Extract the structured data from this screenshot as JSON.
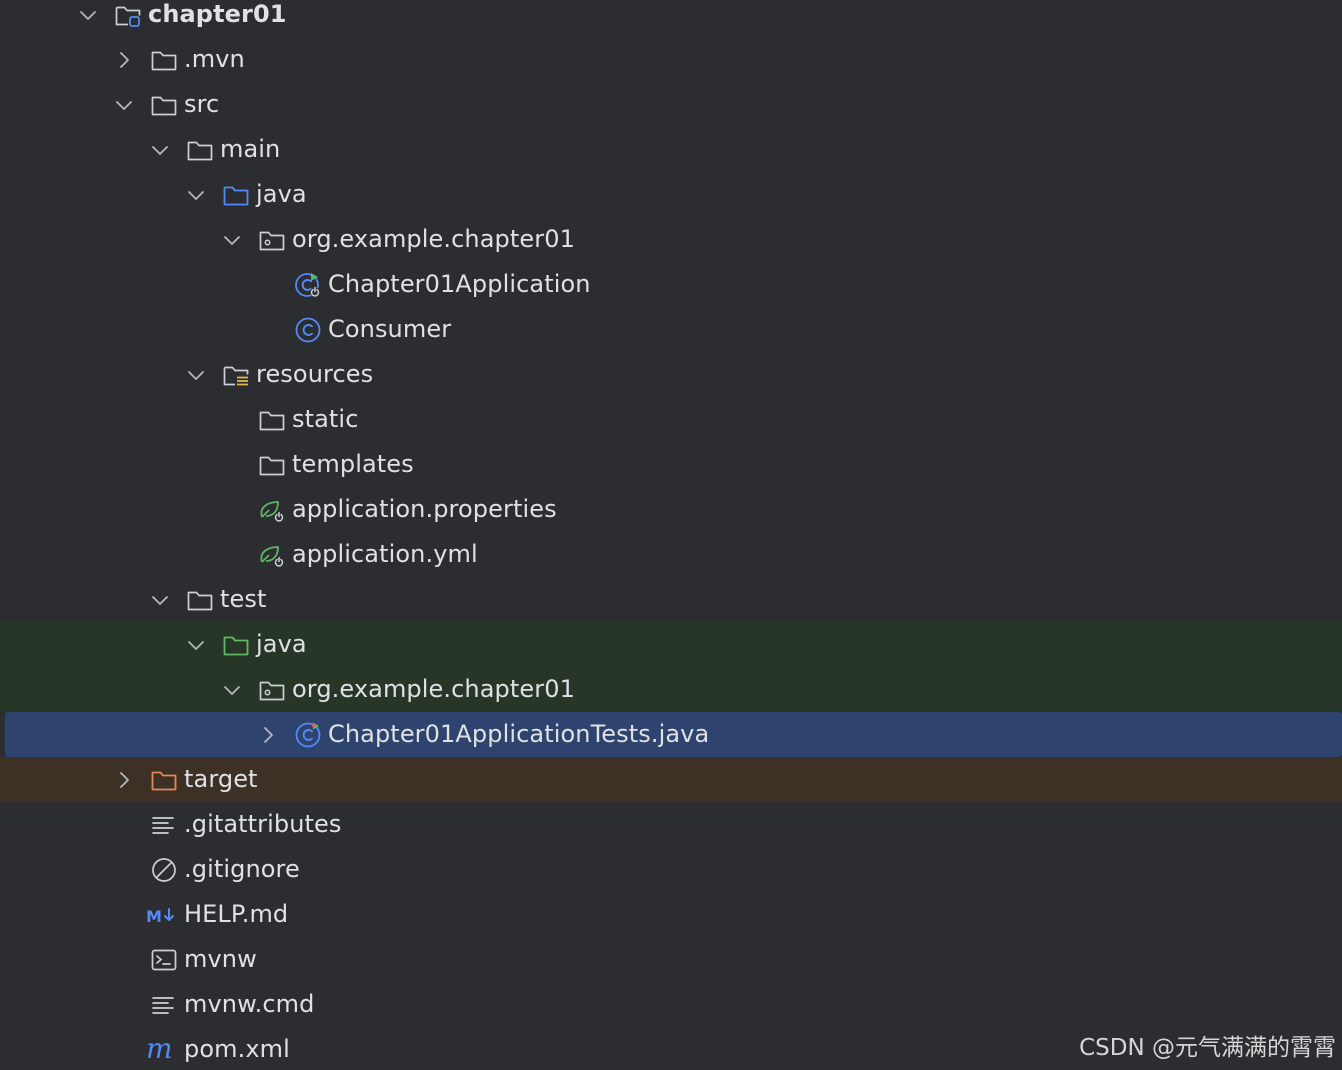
{
  "tree": {
    "items": [
      {
        "label": "chapter01",
        "depth": 0,
        "state": "expanded",
        "icon": "module-folder-icon",
        "bold": true
      },
      {
        "label": ".mvn",
        "depth": 1,
        "state": "collapsed",
        "icon": "folder-icon"
      },
      {
        "label": "src",
        "depth": 1,
        "state": "expanded",
        "icon": "folder-icon"
      },
      {
        "label": "main",
        "depth": 2,
        "state": "expanded",
        "icon": "folder-icon"
      },
      {
        "label": "java",
        "depth": 3,
        "state": "expanded",
        "icon": "source-folder-icon"
      },
      {
        "label": "org.example.chapter01",
        "depth": 4,
        "state": "expanded",
        "icon": "package-icon"
      },
      {
        "label": "Chapter01Application",
        "depth": 5,
        "state": "leaf",
        "icon": "spring-boot-class-icon"
      },
      {
        "label": "Consumer",
        "depth": 5,
        "state": "leaf",
        "icon": "class-icon"
      },
      {
        "label": "resources",
        "depth": 3,
        "state": "expanded",
        "icon": "resources-folder-icon"
      },
      {
        "label": "static",
        "depth": 4,
        "state": "leaf",
        "icon": "folder-icon"
      },
      {
        "label": "templates",
        "depth": 4,
        "state": "leaf",
        "icon": "folder-icon"
      },
      {
        "label": "application.properties",
        "depth": 4,
        "state": "leaf",
        "icon": "spring-config-icon"
      },
      {
        "label": "application.yml",
        "depth": 4,
        "state": "leaf",
        "icon": "spring-config-icon"
      },
      {
        "label": "test",
        "depth": 2,
        "state": "expanded",
        "icon": "folder-icon"
      },
      {
        "label": "java",
        "depth": 3,
        "state": "expanded",
        "icon": "test-folder-icon",
        "highlight": "test"
      },
      {
        "label": "org.example.chapter01",
        "depth": 4,
        "state": "expanded",
        "icon": "package-icon",
        "highlight": "test"
      },
      {
        "label": "Chapter01ApplicationTests.java",
        "depth": 5,
        "state": "collapsed",
        "icon": "test-class-icon",
        "highlight": "selected"
      },
      {
        "label": "target",
        "depth": 1,
        "state": "collapsed",
        "icon": "excluded-folder-icon",
        "highlight": "excluded"
      },
      {
        "label": ".gitattributes",
        "depth": 1,
        "state": "leaf",
        "icon": "text-file-icon"
      },
      {
        "label": ".gitignore",
        "depth": 1,
        "state": "leaf",
        "icon": "ignore-file-icon"
      },
      {
        "label": "HELP.md",
        "depth": 1,
        "state": "leaf",
        "icon": "markdown-icon"
      },
      {
        "label": "mvnw",
        "depth": 1,
        "state": "leaf",
        "icon": "shell-script-icon"
      },
      {
        "label": "mvnw.cmd",
        "depth": 1,
        "state": "leaf",
        "icon": "text-file-icon"
      },
      {
        "label": "pom.xml",
        "depth": 1,
        "state": "leaf",
        "icon": "maven-icon"
      }
    ]
  },
  "watermark": "CSDN @元气满满的霄霄",
  "colors": {
    "background": "#2b2d30",
    "test_row": "#283628",
    "selected_row": "#2e436e",
    "excluded_row": "#3d3024",
    "source_blue": "#548af7",
    "test_green": "#5fb865",
    "excluded_orange": "#e08855"
  }
}
